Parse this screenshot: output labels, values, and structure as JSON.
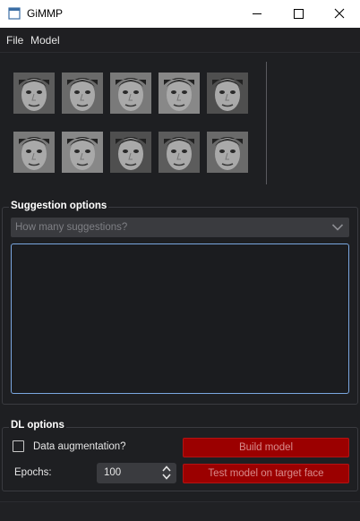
{
  "window": {
    "title": "GiMMP",
    "controls": [
      "minimize-icon",
      "maximize-icon",
      "close-icon"
    ]
  },
  "menu": {
    "items": [
      {
        "label": "File"
      },
      {
        "label": "Model"
      }
    ]
  },
  "faces": {
    "rows": [
      [
        "face-1",
        "face-2",
        "face-3",
        "face-4",
        "face-5"
      ],
      [
        "face-6",
        "face-7",
        "face-8",
        "face-9",
        "face-10"
      ]
    ]
  },
  "suggestion": {
    "group_title": "Suggestion options",
    "combo_placeholder": "How many suggestions?",
    "text_value": ""
  },
  "dl": {
    "group_title": "DL options",
    "augmentation_label": "Data augmentation?",
    "augmentation_checked": false,
    "epochs_label": "Epochs:",
    "epochs_value": "100",
    "build_label": "Build model",
    "test_label": "Test model on target face"
  },
  "colors": {
    "background": "#1e1f22",
    "accent_red": "#9b0000",
    "focus_border": "#7aa7e0"
  }
}
